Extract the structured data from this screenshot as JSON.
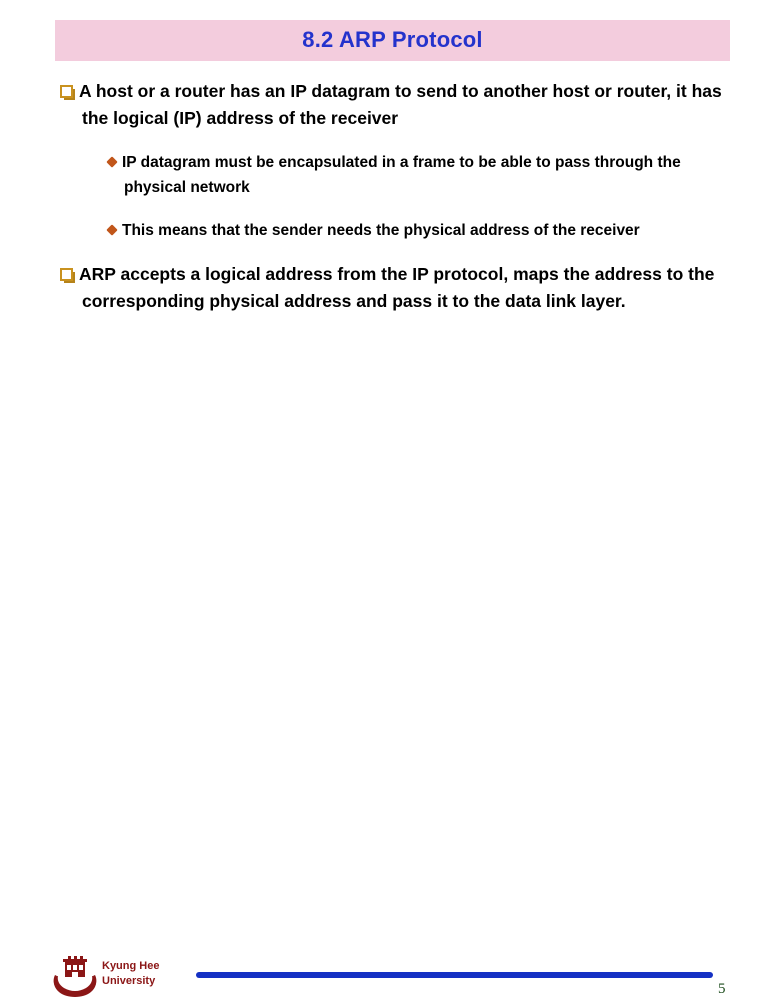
{
  "slide": {
    "title": "8.2 ARP Protocol",
    "title_bg": "#f3ccdd",
    "title_color": "#2433cc",
    "bullets": [
      {
        "level": 1,
        "marker": "square-bullet-icon",
        "text": "A host or a router has an IP datagram to send to another host or router, it has the logical (IP) address of the receiver"
      },
      {
        "level": 2,
        "marker": "diamond-bullet-icon",
        "text": "IP datagram must be encapsulated in a frame to be able to pass through the physical network"
      },
      {
        "level": 2,
        "marker": "diamond-bullet-icon",
        "text": "This means that the sender needs the physical address of the receiver"
      },
      {
        "level": 1,
        "marker": "square-bullet-icon",
        "text": "ARP accepts a logical address from the IP protocol, maps the address to the corresponding physical address and pass it to the data link layer."
      }
    ]
  },
  "footer": {
    "org_line1": "Kyung Hee",
    "org_line2": "University",
    "org_color": "#8b1616",
    "rule_color": "#1531c4",
    "page_number": "5",
    "page_number_color": "#1d4d1d"
  }
}
